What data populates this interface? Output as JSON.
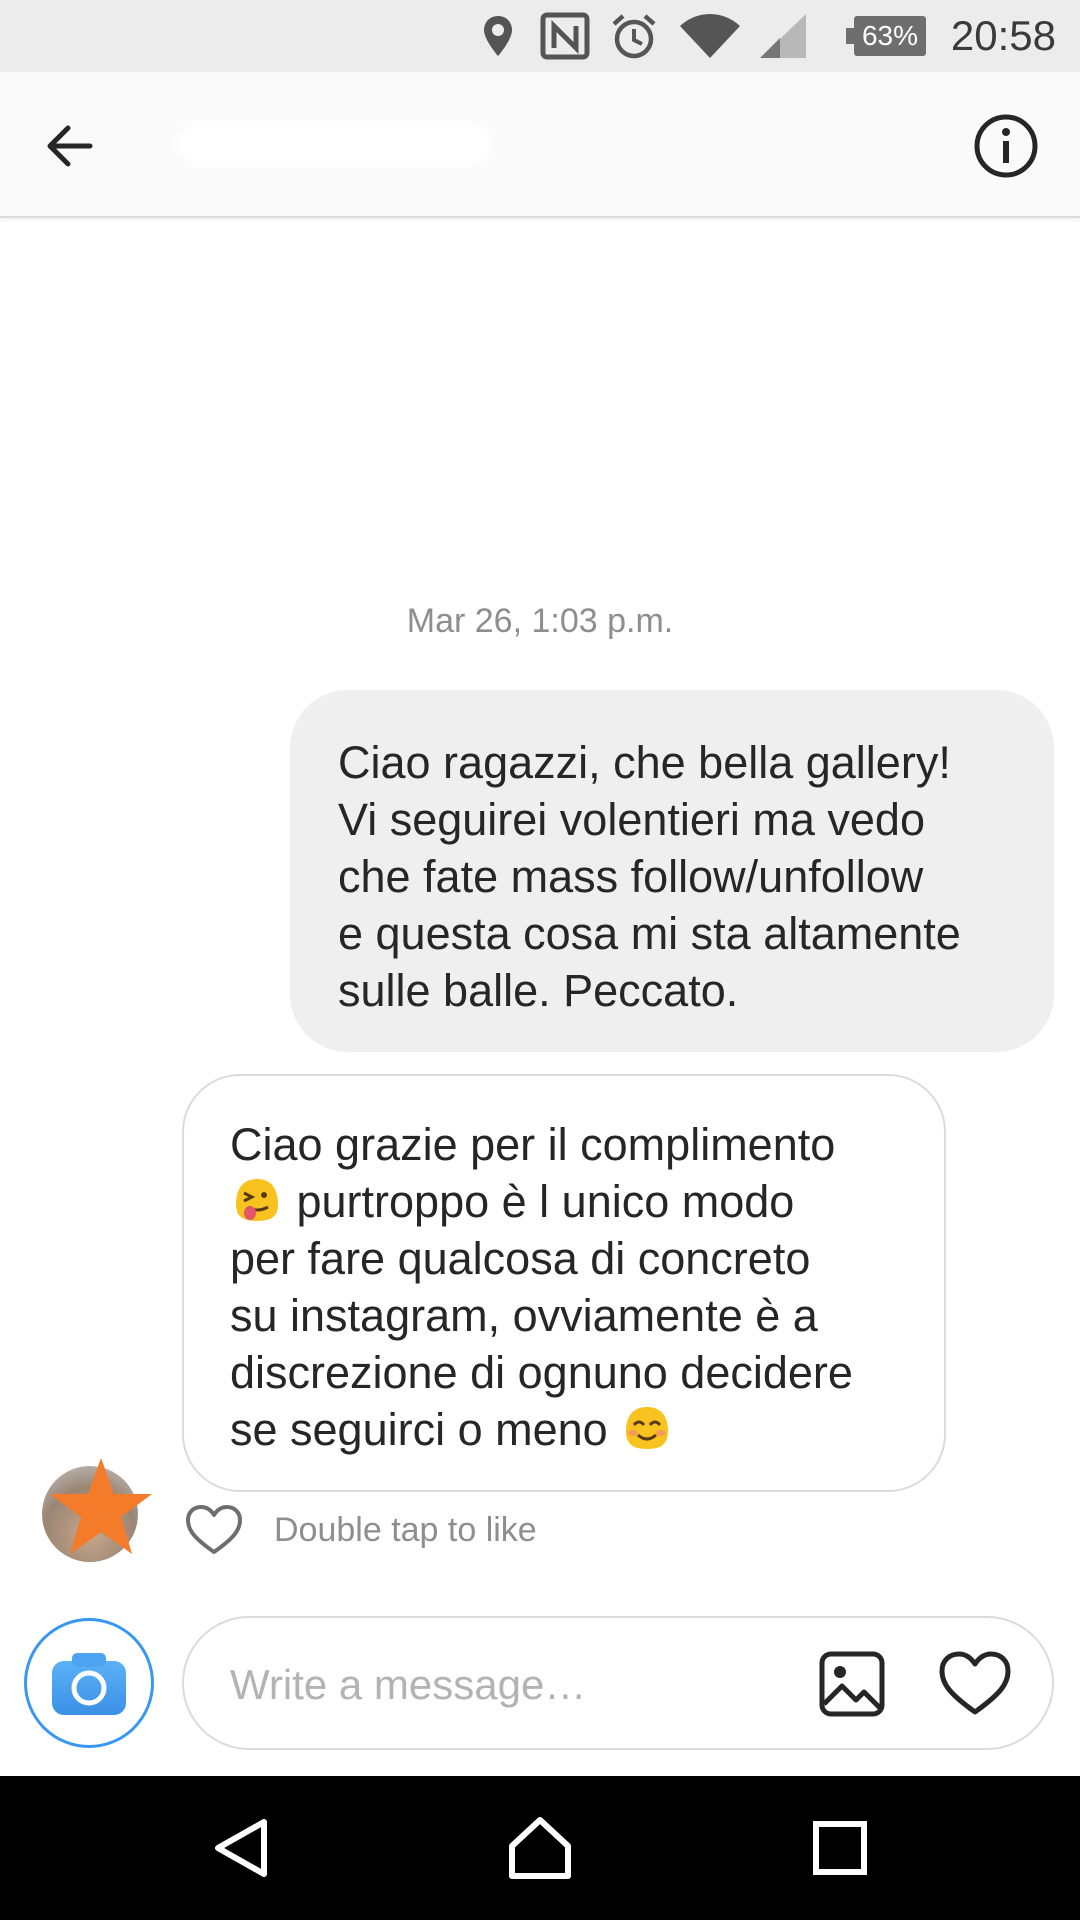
{
  "status_bar": {
    "icons": [
      "location-icon",
      "nfc-icon",
      "alarm-icon",
      "wifi-icon",
      "signal-icon",
      "battery-icon"
    ],
    "battery": "63%",
    "time": "20:58"
  },
  "header": {
    "back_icon": "arrow-left-icon",
    "username": "",
    "info_icon": "info-icon"
  },
  "thread": {
    "timestamp": "Mar 26, 1:03 p.m.",
    "messages": [
      {
        "direction": "outgoing",
        "text": "Ciao ragazzi, che bella gallery!\nVi seguirei volentieri ma vedo\nche fate mass follow/unfollow\ne questa cosa mi sta altamente\nsulle balle. Peccato."
      },
      {
        "direction": "incoming",
        "line1": "Ciao grazie per il complimento",
        "line2": " purtroppo è l unico modo",
        "line3": "per fare qualcosa di concreto\nsu instagram, ovviamente è a\ndiscrezione di ognuno decidere\nse seguirci o meno ",
        "emojis": [
          "tongue-wink-emoji",
          "smiling-eyes-emoji"
        ]
      }
    ],
    "like_hint": "Double tap to like"
  },
  "composer": {
    "placeholder": "Write a message…",
    "camera_icon": "camera-icon",
    "gallery_icon": "image-icon",
    "heart_icon": "heart-icon"
  },
  "nav_bar": {
    "icons": [
      "nav-back-icon",
      "nav-home-icon",
      "nav-recents-icon"
    ]
  },
  "colors": {
    "accent": "#3897f0",
    "bubble_outgoing": "#efefef",
    "secondary_text": "#8e8e8e",
    "avatar_star": "#f47b2a"
  }
}
